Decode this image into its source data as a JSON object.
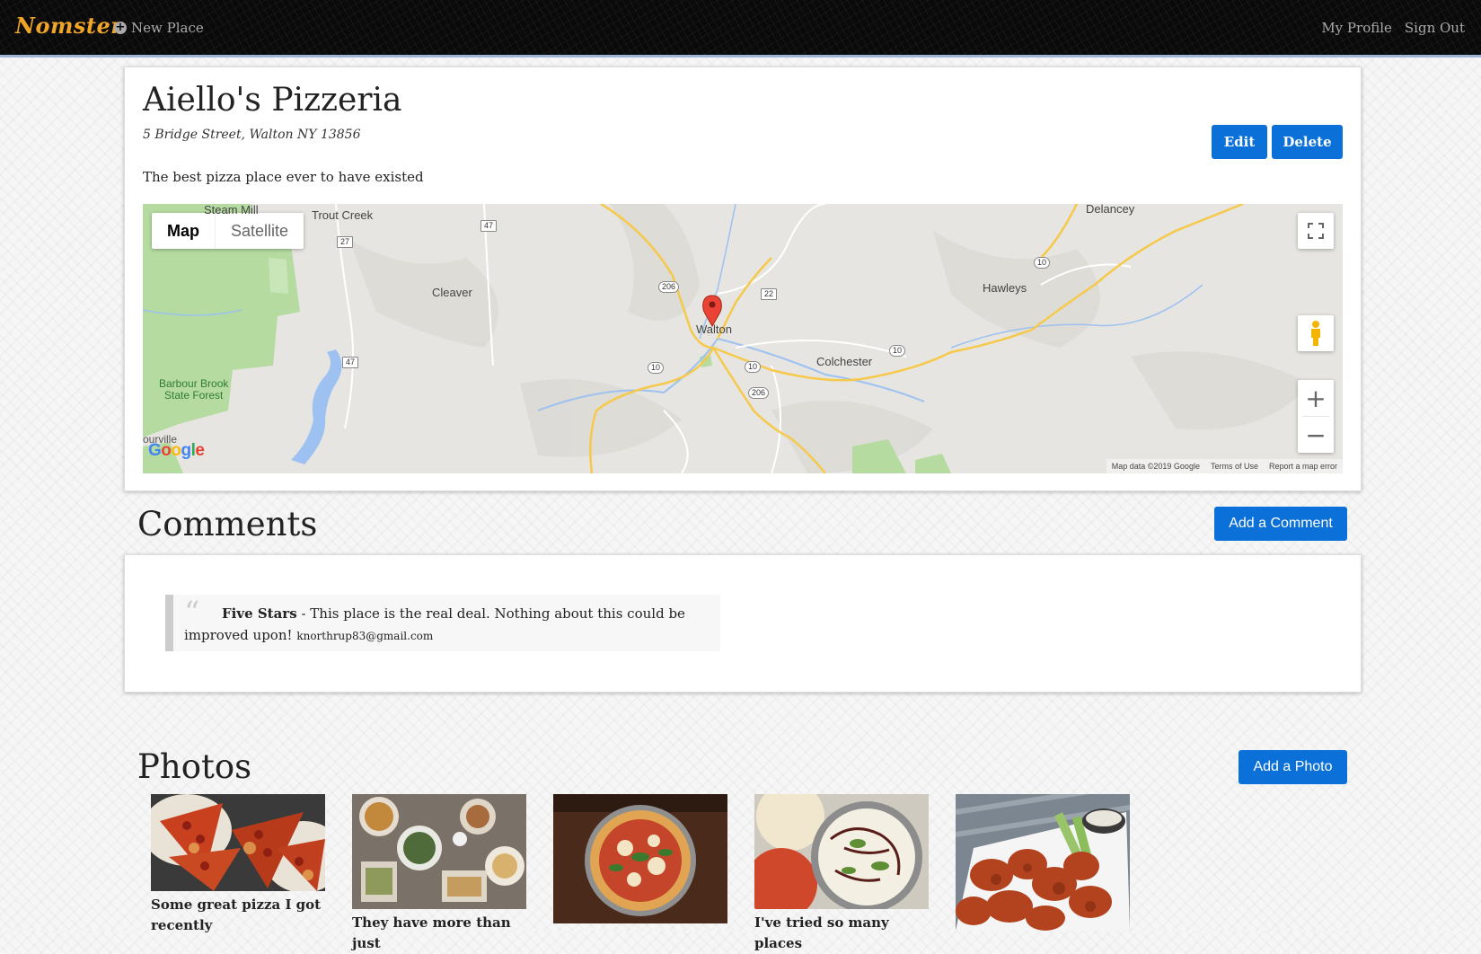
{
  "navbar": {
    "brand": "Nomster",
    "new_place": "New Place",
    "my_profile": "My Profile",
    "sign_out": "Sign Out"
  },
  "place": {
    "name": "Aiello's Pizzeria",
    "address": "5 Bridge Street, Walton NY 13856",
    "description": "The best pizza place ever to have existed",
    "edit_label": "Edit",
    "delete_label": "Delete"
  },
  "map": {
    "type_map": "Map",
    "type_satellite": "Satellite",
    "labels": {
      "steam_mill": "Steam Mill",
      "trout_creek": "Trout Creek",
      "delancey": "Delancey",
      "cleaver": "Cleaver",
      "hawleys": "Hawleys",
      "walton": "Walton",
      "colchester": "Colchester",
      "barbour_brook": "Barbour Brook",
      "state_forest": "State Forest",
      "ourville": "ourville"
    },
    "shields": [
      "47",
      "27",
      "206",
      "22",
      "10",
      "47",
      "10",
      "10",
      "10",
      "206"
    ],
    "logo": "Google",
    "footer": {
      "data": "Map data ©2019 Google",
      "terms": "Terms of Use",
      "report": "Report a map error"
    }
  },
  "comments": {
    "title": "Comments",
    "add_label": "Add a Comment",
    "items": [
      {
        "rating": "Five Stars",
        "message": "This place is the real deal. Nothing about this could be improved upon!",
        "user": "knorthrup83@gmail.com"
      }
    ]
  },
  "photos": {
    "title": "Photos",
    "add_label": "Add a Photo",
    "items": [
      {
        "caption": "Some great pizza I got recently"
      },
      {
        "caption": "They have more than just"
      },
      {
        "caption": ""
      },
      {
        "caption": "I've tried so many places"
      },
      {
        "caption": ""
      }
    ]
  },
  "colors": {
    "brand": "#f0a527",
    "primary_button": "#0b70d8",
    "marker": "#ea4335"
  }
}
